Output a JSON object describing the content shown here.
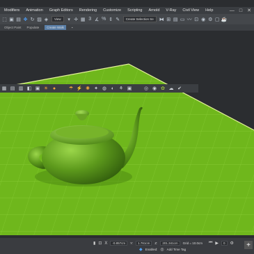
{
  "menu": {
    "items": [
      "Modifiers",
      "Animation",
      "Graph Editors",
      "Rendering",
      "Customize",
      "Scripting",
      "Arnold",
      "V-Ray",
      "Civil View",
      "Help"
    ]
  },
  "window_buttons": {
    "minimize": "—",
    "maximize": "□",
    "close": "✕"
  },
  "toolbar": {
    "view_dropdown": "View",
    "snap_label": "3",
    "selection_set_dropdown": "Create Selection Se"
  },
  "ribbon": {
    "object_paint": "Object Paint",
    "populate": "Populate",
    "active_tab": "Create Walk"
  },
  "status": {
    "x_value": "-0.857cm",
    "y_label": "Y:",
    "y_value": "1.761cm",
    "z_label": "Z:",
    "z_value": "201.341cm",
    "grid_label": "Grid = 10.0cm",
    "enabled_label": "Enabled:",
    "add_time_tag": "Add Time Tag",
    "frame_value": "0"
  },
  "colors": {
    "background": "#2b2d30",
    "ground": "#6fb71c",
    "teapot": "#5d9a1c",
    "accent": "#4fa3ff"
  },
  "icons": {
    "toolbar1": [
      "link-icon",
      "unlink-icon",
      "bind-icon",
      "select-icon",
      "select-region-icon",
      "move-icon",
      "rotate-icon",
      "scale-icon",
      "select-by-name-icon",
      "pivot-icon",
      "snap-icon",
      "angle-snap-icon",
      "percent-snap-icon",
      "spinner-snap-icon",
      "named-selection-icon",
      "mirror-icon",
      "align-icon",
      "layer-icon",
      "graphite-icon",
      "curve-editor-icon",
      "schematic-icon",
      "material-editor-icon",
      "render-setup-icon",
      "render-frame-icon",
      "render-icon",
      "active-shade-icon"
    ],
    "viewport_toolbar": [
      "grid-icon",
      "layers-icon",
      "display-icon",
      "camera-icon",
      "light-icon",
      "sun-icon",
      "teapot-icon",
      "sphere-icon",
      "box-icon",
      "tree-icon",
      "explode-icon",
      "helper-icon",
      "particle-icon",
      "spacewarp-icon",
      "system-icon",
      "checker-icon",
      "material-icon",
      "render-icon",
      "vray-icon",
      "check-icon"
    ]
  }
}
